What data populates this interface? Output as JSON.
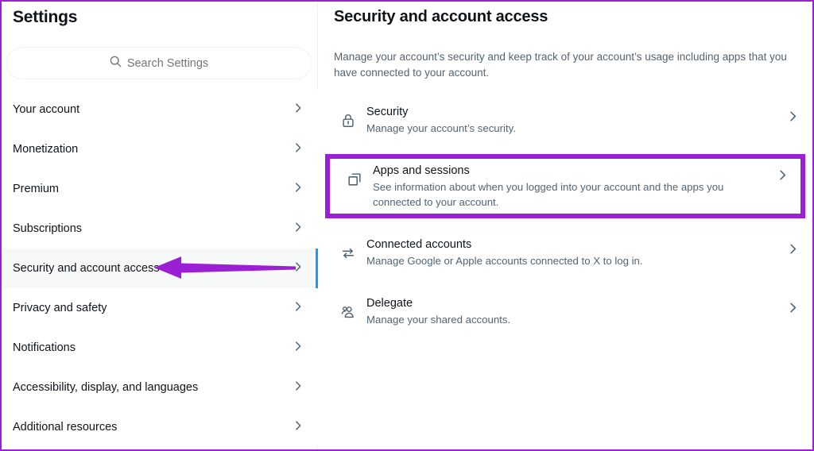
{
  "theme": {
    "annotation_purple": "#9b1fd4",
    "accent_blue": "#1d9bf0",
    "text_primary": "#0f1419",
    "text_secondary": "#536471",
    "active_row_bg": "#f7f9f9"
  },
  "sidebar": {
    "title": "Settings",
    "search": {
      "placeholder": "Search Settings",
      "icon": "search-icon",
      "value": ""
    },
    "items": [
      {
        "label": "Your account",
        "icon": "chevron-right-icon",
        "active": false
      },
      {
        "label": "Monetization",
        "icon": "chevron-right-icon",
        "active": false
      },
      {
        "label": "Premium",
        "icon": "chevron-right-icon",
        "active": false
      },
      {
        "label": "Subscriptions",
        "icon": "chevron-right-icon",
        "active": false
      },
      {
        "label": "Security and account access",
        "icon": "chevron-right-icon",
        "active": true
      },
      {
        "label": "Privacy and safety",
        "icon": "chevron-right-icon",
        "active": false
      },
      {
        "label": "Notifications",
        "icon": "chevron-right-icon",
        "active": false
      },
      {
        "label": "Accessibility, display, and languages",
        "icon": "chevron-right-icon",
        "active": false
      },
      {
        "label": "Additional resources",
        "icon": "chevron-right-icon",
        "active": false
      }
    ]
  },
  "main": {
    "title": "Security and account access",
    "description": "Manage your account’s security and keep track of your account’s usage including apps that you have connected to your account.",
    "rows": [
      {
        "title": "Security",
        "subtitle": "Manage your account’s security.",
        "icon": "lock-icon",
        "chevron": "chevron-right-icon",
        "highlighted": false
      },
      {
        "title": "Apps and sessions",
        "subtitle": "See information about when you logged into your account and the apps you connected to your account.",
        "icon": "stacked-squares-icon",
        "chevron": "chevron-right-icon",
        "highlighted": true
      },
      {
        "title": "Connected accounts",
        "subtitle": "Manage Google or Apple accounts connected to X to log in.",
        "icon": "swap-arrows-icon",
        "chevron": "chevron-right-icon",
        "highlighted": false
      },
      {
        "title": "Delegate",
        "subtitle": "Manage your shared accounts.",
        "icon": "people-icon",
        "chevron": "chevron-right-icon",
        "highlighted": false
      }
    ]
  },
  "annotations": {
    "arrow": {
      "icon": "left-arrow-annotation-icon",
      "points_to": "Security and account access",
      "color": "#9b1fd4"
    },
    "box": {
      "icon": "highlight-box-annotation",
      "surrounds": "Apps and sessions",
      "color": "#9b1fd4"
    }
  }
}
